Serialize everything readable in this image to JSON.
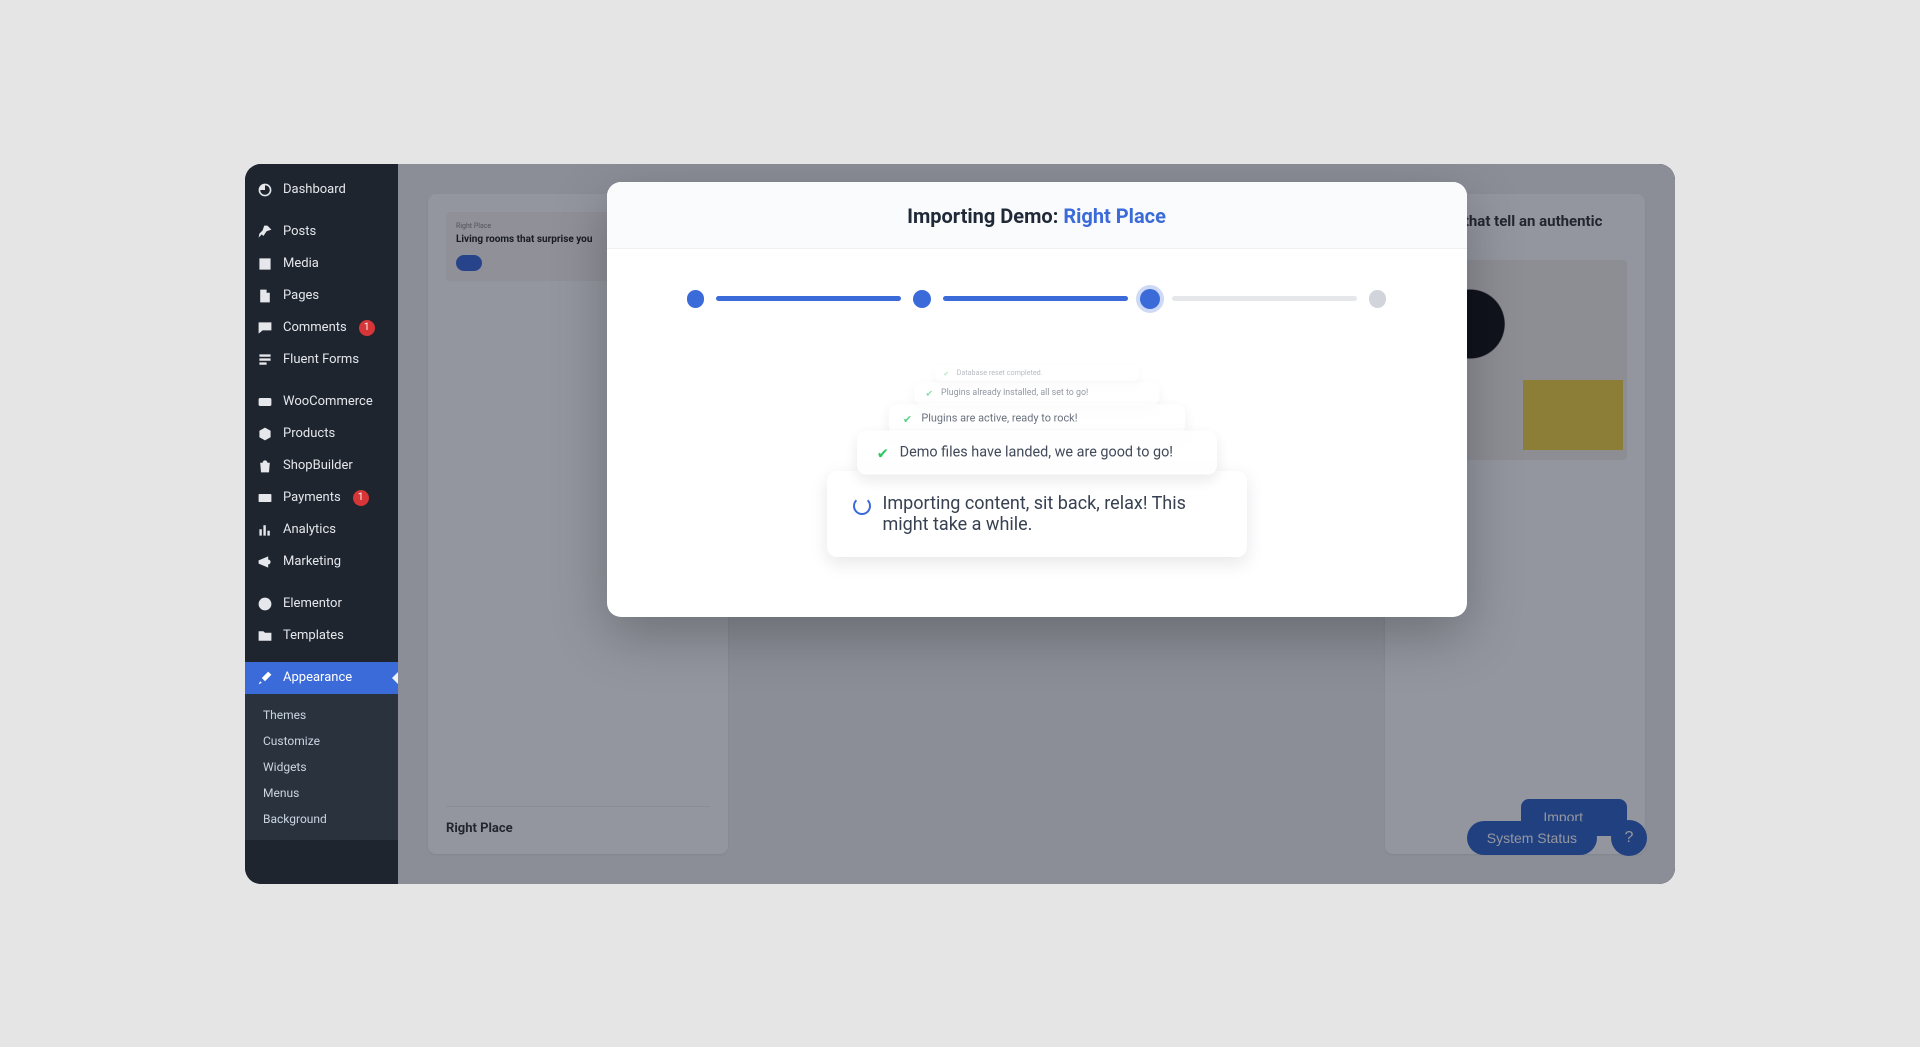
{
  "sidebar": {
    "items": [
      {
        "label": "Dashboard"
      },
      {
        "label": "Posts"
      },
      {
        "label": "Media"
      },
      {
        "label": "Pages"
      },
      {
        "label": "Comments",
        "badge": "1"
      },
      {
        "label": "Fluent Forms"
      },
      {
        "label": "WooCommerce"
      },
      {
        "label": "Products"
      },
      {
        "label": "ShopBuilder"
      },
      {
        "label": "Payments",
        "badge": "1"
      },
      {
        "label": "Analytics"
      },
      {
        "label": "Marketing"
      },
      {
        "label": "Elementor"
      },
      {
        "label": "Templates"
      },
      {
        "label": "Appearance"
      }
    ],
    "submenu": [
      "Themes",
      "Customize",
      "Widgets",
      "Menus",
      "Background"
    ]
  },
  "background": {
    "left_card": {
      "mini_tag": "Right Place",
      "headline": "Living rooms that surprise you",
      "footer": "Right Place"
    },
    "right_card": {
      "headline": "Interiors that tell an authentic story",
      "import_label": "Import"
    },
    "system_status": "System Status",
    "help": "?"
  },
  "modal": {
    "title_prefix": "Importing Demo: ",
    "demo_name": "Right Place",
    "steps": [
      {
        "state": "done"
      },
      {
        "state": "done"
      },
      {
        "state": "current"
      },
      {
        "state": "pending"
      }
    ],
    "log": [
      {
        "status": "done",
        "text": "Database reset completed."
      },
      {
        "status": "done",
        "text": "Plugins already installed, all set to go!"
      },
      {
        "status": "done",
        "text": "Plugins are active, ready to rock!"
      },
      {
        "status": "done",
        "text": "Demo files have landed, we are good to go!"
      },
      {
        "status": "loading",
        "text": "Importing content, sit back, relax! This might take a while."
      }
    ]
  }
}
